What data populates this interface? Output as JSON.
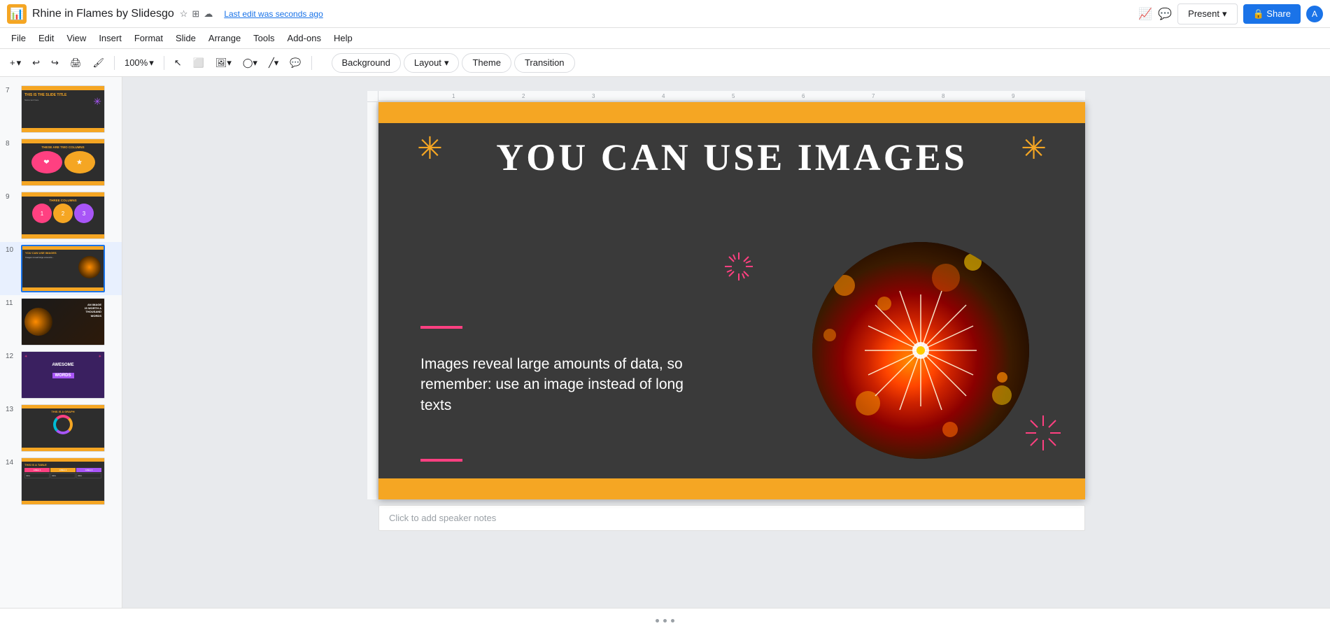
{
  "app": {
    "icon": "🟧",
    "title": "Rhine in Flames by Slidesgo",
    "star_icon": "☆",
    "dashboard_icon": "⊞",
    "cloud_icon": "☁",
    "last_edit": "Last edit was seconds ago"
  },
  "menubar": {
    "items": [
      "File",
      "Edit",
      "View",
      "Insert",
      "Format",
      "Slide",
      "Arrange",
      "Tools",
      "Add-ons",
      "Help"
    ]
  },
  "toolbar": {
    "add_btn": "+",
    "undo": "↩",
    "redo": "↪",
    "print": "🖨",
    "paint": "🖌",
    "zoom": "100%",
    "select_arrow": "↖",
    "select_box": "⬜",
    "image_insert": "🖼",
    "shape": "◯",
    "line": "╱",
    "comment": "💬",
    "background_btn": "Background",
    "layout_btn": "Layout",
    "layout_arrow": "▾",
    "theme_btn": "Theme",
    "transition_btn": "Transition"
  },
  "header_right": {
    "present_label": "Present",
    "present_arrow": "▾",
    "share_label": "🔒 Share",
    "account_icon": "🌐"
  },
  "slides": [
    {
      "num": "7",
      "type": "title_slide",
      "title": "THIS IS THE SLIDE TITLE",
      "active": false
    },
    {
      "num": "8",
      "type": "two_columns",
      "title": "THESE ARE TWO COLUMNS",
      "active": false
    },
    {
      "num": "9",
      "type": "three_columns",
      "title": "THREE COLUMNS",
      "active": false
    },
    {
      "num": "10",
      "type": "images",
      "title": "YOU CAN USE IMAGES",
      "active": true
    },
    {
      "num": "11",
      "type": "thousand_words",
      "title": "AN IMAGE IS WORTH A THOUSAND WORDS",
      "active": false
    },
    {
      "num": "12",
      "type": "awesome_words",
      "title": "AWESOME WORDS",
      "active": false
    },
    {
      "num": "13",
      "type": "graph",
      "title": "THIS IS A GRAPH",
      "active": false
    },
    {
      "num": "14",
      "type": "table",
      "title": "THIS IS A TABLE",
      "active": false
    }
  ],
  "current_slide": {
    "top_bar_color": "#f5a623",
    "bottom_bar_color": "#f5a623",
    "background_color": "#3a3a3a",
    "title": "YOU CAN USE IMAGES",
    "body_text": "Images reveal large amounts of data, so remember: use an image instead of long texts",
    "accent_color_pink": "#ff4081",
    "accent_color_gold": "#f5a623"
  },
  "speaker_notes": {
    "placeholder": "Click to add speaker notes"
  },
  "bottom_bar": {
    "dots": 3
  }
}
